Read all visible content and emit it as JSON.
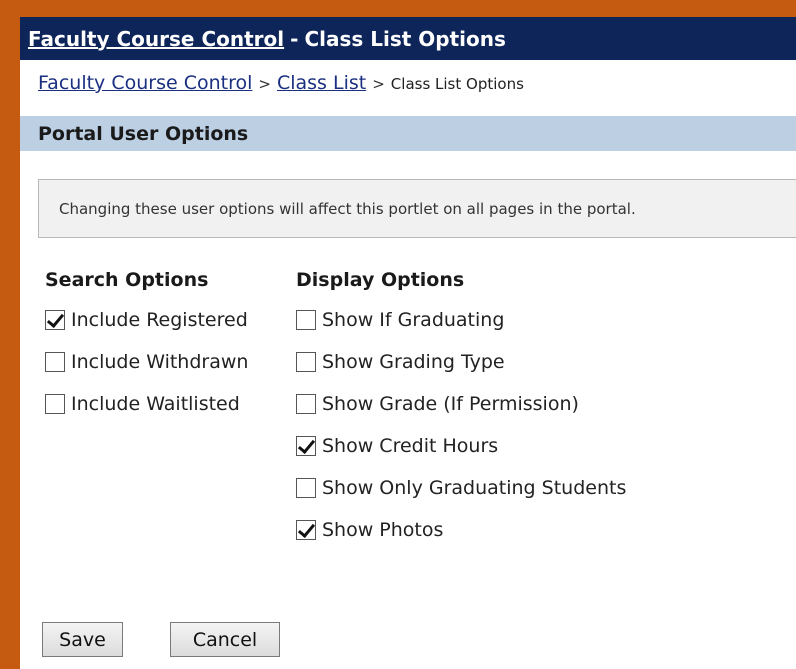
{
  "title_bar": {
    "link_text": "Faculty Course Control",
    "separator": "-",
    "subtitle": "Class List Options"
  },
  "breadcrumb": {
    "items": [
      {
        "label": "Faculty Course Control",
        "link": true
      },
      {
        "label": "Class List",
        "link": true
      },
      {
        "label": "Class List Options",
        "link": false
      }
    ],
    "separator": ">"
  },
  "section_header": "Portal User Options",
  "notice": "Changing these user options will affect this portlet on all pages in the portal.",
  "search_options": {
    "heading": "Search Options",
    "items": [
      {
        "label": "Include Registered",
        "checked": true
      },
      {
        "label": "Include Withdrawn",
        "checked": false
      },
      {
        "label": "Include Waitlisted",
        "checked": false
      }
    ]
  },
  "display_options": {
    "heading": "Display Options",
    "items": [
      {
        "label": "Show If Graduating",
        "checked": false
      },
      {
        "label": "Show Grading Type",
        "checked": false
      },
      {
        "label": "Show Grade (If Permission)",
        "checked": false
      },
      {
        "label": "Show Credit Hours",
        "checked": true
      },
      {
        "label": "Show Only Graduating Students",
        "checked": false
      },
      {
        "label": "Show Photos",
        "checked": true
      }
    ]
  },
  "buttons": {
    "save_label": "Save",
    "cancel_label": "Cancel"
  },
  "colors": {
    "frame": "#c55a11",
    "title_bar": "#0d2559",
    "section_header": "#bccfe3",
    "link": "#1a2f80"
  }
}
